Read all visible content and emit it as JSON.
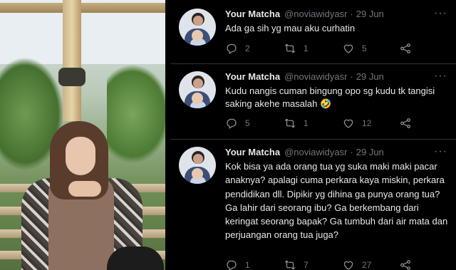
{
  "tweets": [
    {
      "name": "Your Matcha",
      "handle": "@noviawidyasr",
      "dot": "·",
      "date": "29 Jun",
      "more": "···",
      "text": "Ada ga sih yg mau aku curhatin",
      "replies": "2",
      "retweets": "1",
      "likes": "5"
    },
    {
      "name": "Your Matcha",
      "handle": "@noviawidyasr",
      "dot": "·",
      "date": "29 Jun",
      "more": "···",
      "text": "Kudu nangis cuman bingung opo sg kudu tk tangisi saking akehe masalah 🤣",
      "replies": "5",
      "retweets": "1",
      "likes": "12"
    },
    {
      "name": "Your Matcha",
      "handle": "@noviawidyasr",
      "dot": "·",
      "date": "29 Jun",
      "more": "···",
      "text": "Kok bisa ya ada orang tua yg suka maki maki pacar anaknya? apalagi cuma perkara kaya miskin, perkara pendidikan dll. Dipikir yg dihina ga punya orang tua? Ga lahir dari seorang ibu? Ga berkembang dari keringat seorang bapak? Ga tumbuh dari air mata dan perjuangan orang tua juga?",
      "replies": "1",
      "retweets": "7",
      "likes": "27"
    }
  ],
  "icons": {
    "reply": "reply-icon",
    "retweet": "retweet-icon",
    "like": "heart-icon",
    "share": "share-icon",
    "more": "more-icon"
  },
  "colors": {
    "background": "#000000",
    "primary_text": "#e7e9ea",
    "secondary_text": "#71767b",
    "divider": "#2f3336"
  }
}
